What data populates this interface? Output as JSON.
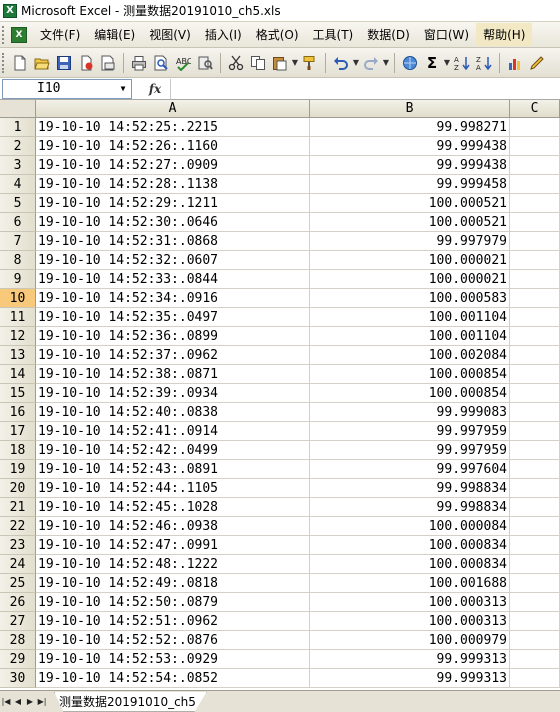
{
  "window": {
    "title": "Microsoft Excel - 测量数据20191010_ch5.xls",
    "app_icon": "X"
  },
  "menu": [
    "文件(F)",
    "编辑(E)",
    "视图(V)",
    "插入(I)",
    "格式(O)",
    "工具(T)",
    "数据(D)",
    "窗口(W)",
    "帮助(H)"
  ],
  "toolbar": {
    "icons": [
      "new-icon",
      "open-icon",
      "save-icon",
      "permission-icon",
      "email-icon",
      "print-icon",
      "print-preview-icon",
      "spelling-icon",
      "research-icon",
      "cut-icon",
      "copy-icon",
      "paste-icon",
      "format-painter-icon",
      "undo-icon",
      "redo-icon",
      "hyperlink-icon",
      "autosum-icon",
      "sort-asc-icon",
      "sort-desc-icon",
      "chart-icon",
      "drawing-icon"
    ],
    "autosum_glyph": "Σ"
  },
  "formula_bar": {
    "name_box": "I10",
    "fx_label": "fx",
    "formula": ""
  },
  "columns": [
    "A",
    "B",
    "C"
  ],
  "active_row": "10",
  "rows": [
    {
      "n": "1",
      "a": "19-10-10 14:52:25:.2215",
      "b": "99.998271"
    },
    {
      "n": "2",
      "a": "19-10-10 14:52:26:.1160",
      "b": "99.999438"
    },
    {
      "n": "3",
      "a": "19-10-10 14:52:27:.0909",
      "b": "99.999438"
    },
    {
      "n": "4",
      "a": "19-10-10 14:52:28:.1138",
      "b": "99.999458"
    },
    {
      "n": "5",
      "a": "19-10-10 14:52:29:.1211",
      "b": "100.000521"
    },
    {
      "n": "6",
      "a": "19-10-10 14:52:30:.0646",
      "b": "100.000521"
    },
    {
      "n": "7",
      "a": "19-10-10 14:52:31:.0868",
      "b": "99.997979"
    },
    {
      "n": "8",
      "a": "19-10-10 14:52:32:.0607",
      "b": "100.000021"
    },
    {
      "n": "9",
      "a": "19-10-10 14:52:33:.0844",
      "b": "100.000021"
    },
    {
      "n": "10",
      "a": "19-10-10 14:52:34:.0916",
      "b": "100.000583"
    },
    {
      "n": "11",
      "a": "19-10-10 14:52:35:.0497",
      "b": "100.001104"
    },
    {
      "n": "12",
      "a": "19-10-10 14:52:36:.0899",
      "b": "100.001104"
    },
    {
      "n": "13",
      "a": "19-10-10 14:52:37:.0962",
      "b": "100.002084"
    },
    {
      "n": "14",
      "a": "19-10-10 14:52:38:.0871",
      "b": "100.000854"
    },
    {
      "n": "15",
      "a": "19-10-10 14:52:39:.0934",
      "b": "100.000854"
    },
    {
      "n": "16",
      "a": "19-10-10 14:52:40:.0838",
      "b": "99.999083"
    },
    {
      "n": "17",
      "a": "19-10-10 14:52:41:.0914",
      "b": "99.997959"
    },
    {
      "n": "18",
      "a": "19-10-10 14:52:42:.0499",
      "b": "99.997959"
    },
    {
      "n": "19",
      "a": "19-10-10 14:52:43:.0891",
      "b": "99.997604"
    },
    {
      "n": "20",
      "a": "19-10-10 14:52:44:.1105",
      "b": "99.998834"
    },
    {
      "n": "21",
      "a": "19-10-10 14:52:45:.1028",
      "b": "99.998834"
    },
    {
      "n": "22",
      "a": "19-10-10 14:52:46:.0938",
      "b": "100.000084"
    },
    {
      "n": "23",
      "a": "19-10-10 14:52:47:.0991",
      "b": "100.000834"
    },
    {
      "n": "24",
      "a": "19-10-10 14:52:48:.1222",
      "b": "100.000834"
    },
    {
      "n": "25",
      "a": "19-10-10 14:52:49:.0818",
      "b": "100.001688"
    },
    {
      "n": "26",
      "a": "19-10-10 14:52:50:.0879",
      "b": "100.000313"
    },
    {
      "n": "27",
      "a": "19-10-10 14:52:51:.0962",
      "b": "100.000313"
    },
    {
      "n": "28",
      "a": "19-10-10 14:52:52:.0876",
      "b": "100.000979"
    },
    {
      "n": "29",
      "a": "19-10-10 14:52:53:.0929",
      "b": "99.999313"
    },
    {
      "n": "30",
      "a": "19-10-10 14:52:54:.0852",
      "b": "99.999313"
    }
  ],
  "sheet_tabs": [
    "测量数据20191010_ch5"
  ],
  "tab_nav": [
    "|◀",
    "◀",
    "▶",
    "▶|"
  ]
}
